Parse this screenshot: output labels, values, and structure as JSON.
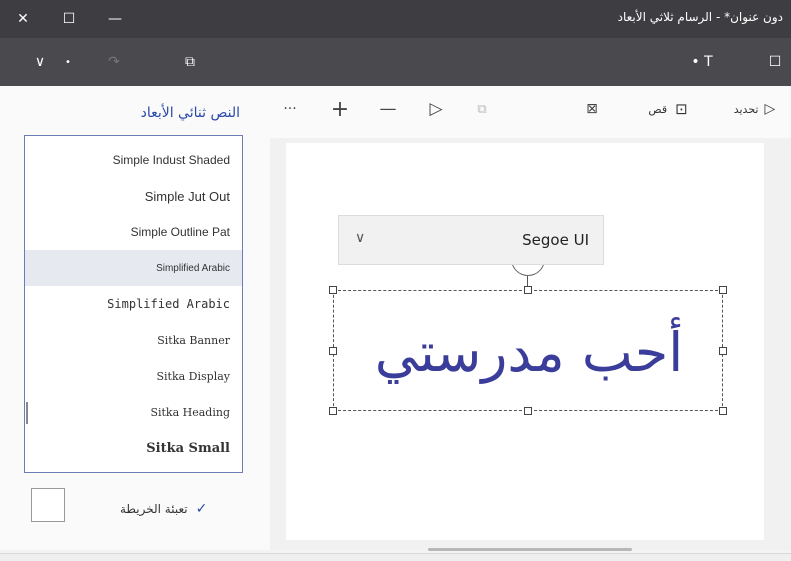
{
  "window": {
    "title": "دون عنوان* - الرسام ثلاثي الأبعاد",
    "close_glyph": "✕",
    "maximize_glyph": "☐",
    "minimize_glyph": "—"
  },
  "ribbon": {
    "down_glyph": "∨",
    "dot_glyph": "•",
    "redo_glyph": "↷",
    "stickers_glyph": "⧉",
    "text_glyph": "• T",
    "canvas_glyph": "☐"
  },
  "toolbar": {
    "more_glyph": "···",
    "plus_glyph": "+",
    "minus_glyph": "—",
    "shape_glyph": "▷",
    "copy_glyph": "⧉",
    "magic_glyph": "⊠",
    "crop_label": "قص",
    "crop_glyph": "⊡",
    "select_label": "تحديد",
    "select_glyph": "▷"
  },
  "panel": {
    "title": "النص ثنائي الأبعاد",
    "fonts": [
      "Simple Indust Shaded",
      "Simple Jut Out",
      "Simple Outline Pat",
      "Simplified Arabic",
      "Simplified Arabic",
      "Sitka Banner",
      "Sitka Display",
      "Sitka Heading",
      "Sitka Small"
    ],
    "selected_font_index": 3,
    "fill_label": "تعبئة الخريطة",
    "fill_checked": true,
    "check_glyph": "✓"
  },
  "canvas": {
    "font_dropdown_value": "Segoe UI",
    "chevron_glyph": "∨",
    "text": "أحب مدرستي",
    "text_color": "#3a3d99"
  }
}
